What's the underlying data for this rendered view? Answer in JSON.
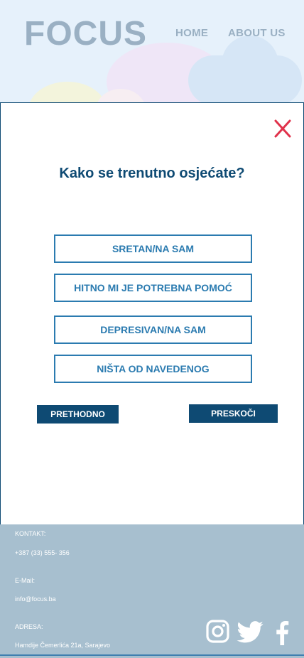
{
  "header": {
    "logo": "FOCUS",
    "nav": {
      "home": "HOME",
      "about": "ABOUT US"
    }
  },
  "modal": {
    "question": "Kako se trenutno osjećate?",
    "options": [
      "SRETAN/NA SAM",
      "HITNO MI JE POTREBNA POMOĆ",
      "DEPRESIVAN/NA SAM",
      "NIŠTA OD NAVEDENOG"
    ],
    "prev_label": "PRETHODNO",
    "skip_label": "PRESKOČI"
  },
  "footer": {
    "contact_label": "KONTAKT:",
    "phone": "+387 (33) 555- 356",
    "email_label": "E-Mail:",
    "email": "info@focus.ba",
    "address_label": "ADRESA:",
    "address": "Hamdije Čemerlića 21a, Sarajevo"
  },
  "colors": {
    "primary": "#0e4a73",
    "option_border": "#2b7bb0",
    "close": "#e0324b",
    "footer_bg": "#a7bfcf",
    "header_bg": "#e6f1fb"
  },
  "icons": [
    "close-icon",
    "instagram-icon",
    "twitter-icon",
    "facebook-icon"
  ]
}
